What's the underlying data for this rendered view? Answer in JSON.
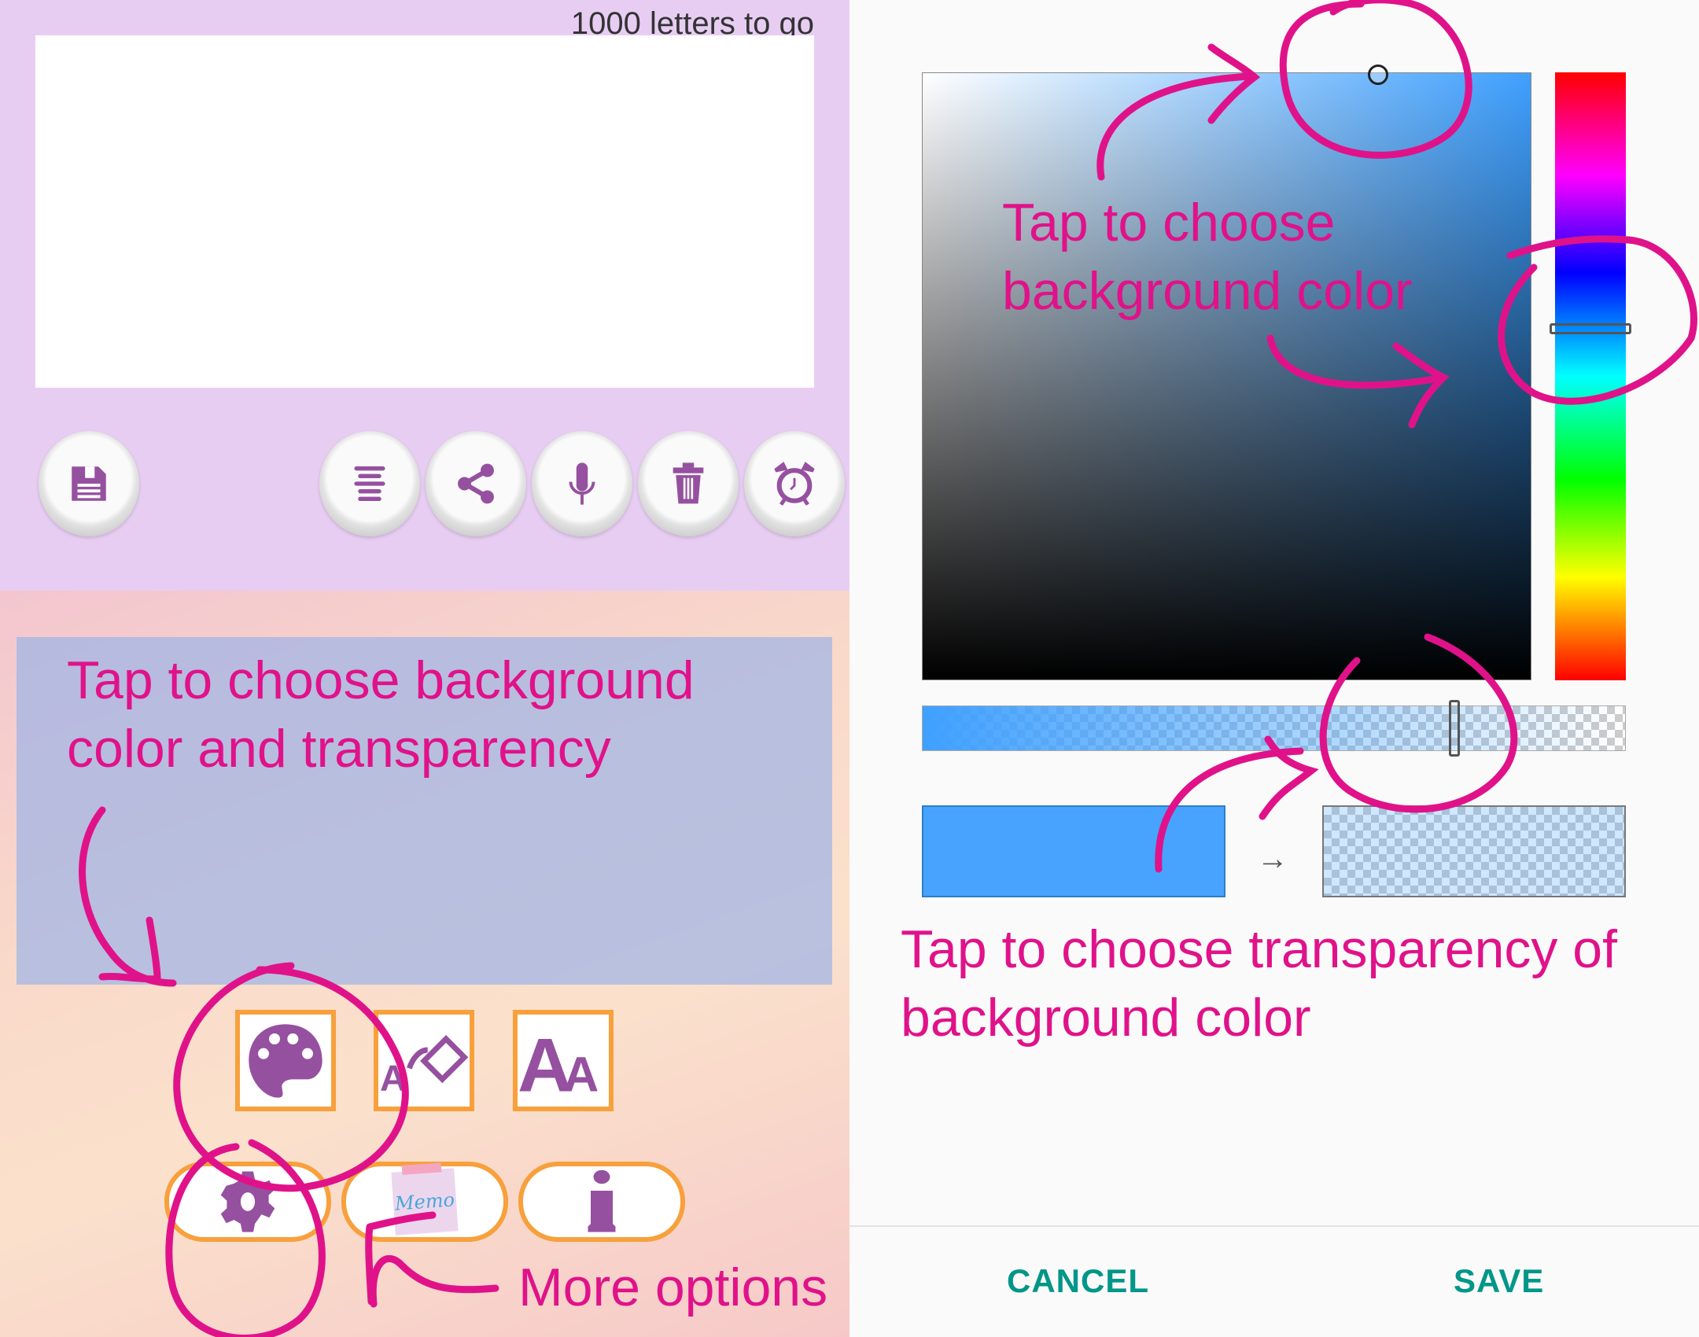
{
  "editor": {
    "counter": "1000 letters to go",
    "text": ""
  },
  "toolbar": {
    "buttons": [
      "save-icon",
      "align-center-icon",
      "share-icon",
      "microphone-icon",
      "trash-icon",
      "alarm-clock-icon"
    ]
  },
  "options": {
    "squares": [
      "palette-icon",
      "text-fill-icon",
      "font-size-icon"
    ],
    "pills": [
      "gear-icon",
      "memo-icon",
      "info-icon"
    ],
    "memo_label": "Memo"
  },
  "annotations": {
    "left_line1": "Tap to choose background",
    "left_line2": "color and transparency",
    "more_options": "More options",
    "right_top_line1": "Tap to choose",
    "right_top_line2": "background color",
    "right_bottom_line1": "Tap to choose transparency of",
    "right_bottom_line2": "background color",
    "color": "#e0128a"
  },
  "color_picker": {
    "hue_color": "#3fa0ff",
    "current_color": "#47a3ff",
    "alpha_percent": 76,
    "arrow": "→"
  },
  "dialog": {
    "cancel": "CANCEL",
    "save": "SAVE",
    "button_color": "#009688"
  }
}
